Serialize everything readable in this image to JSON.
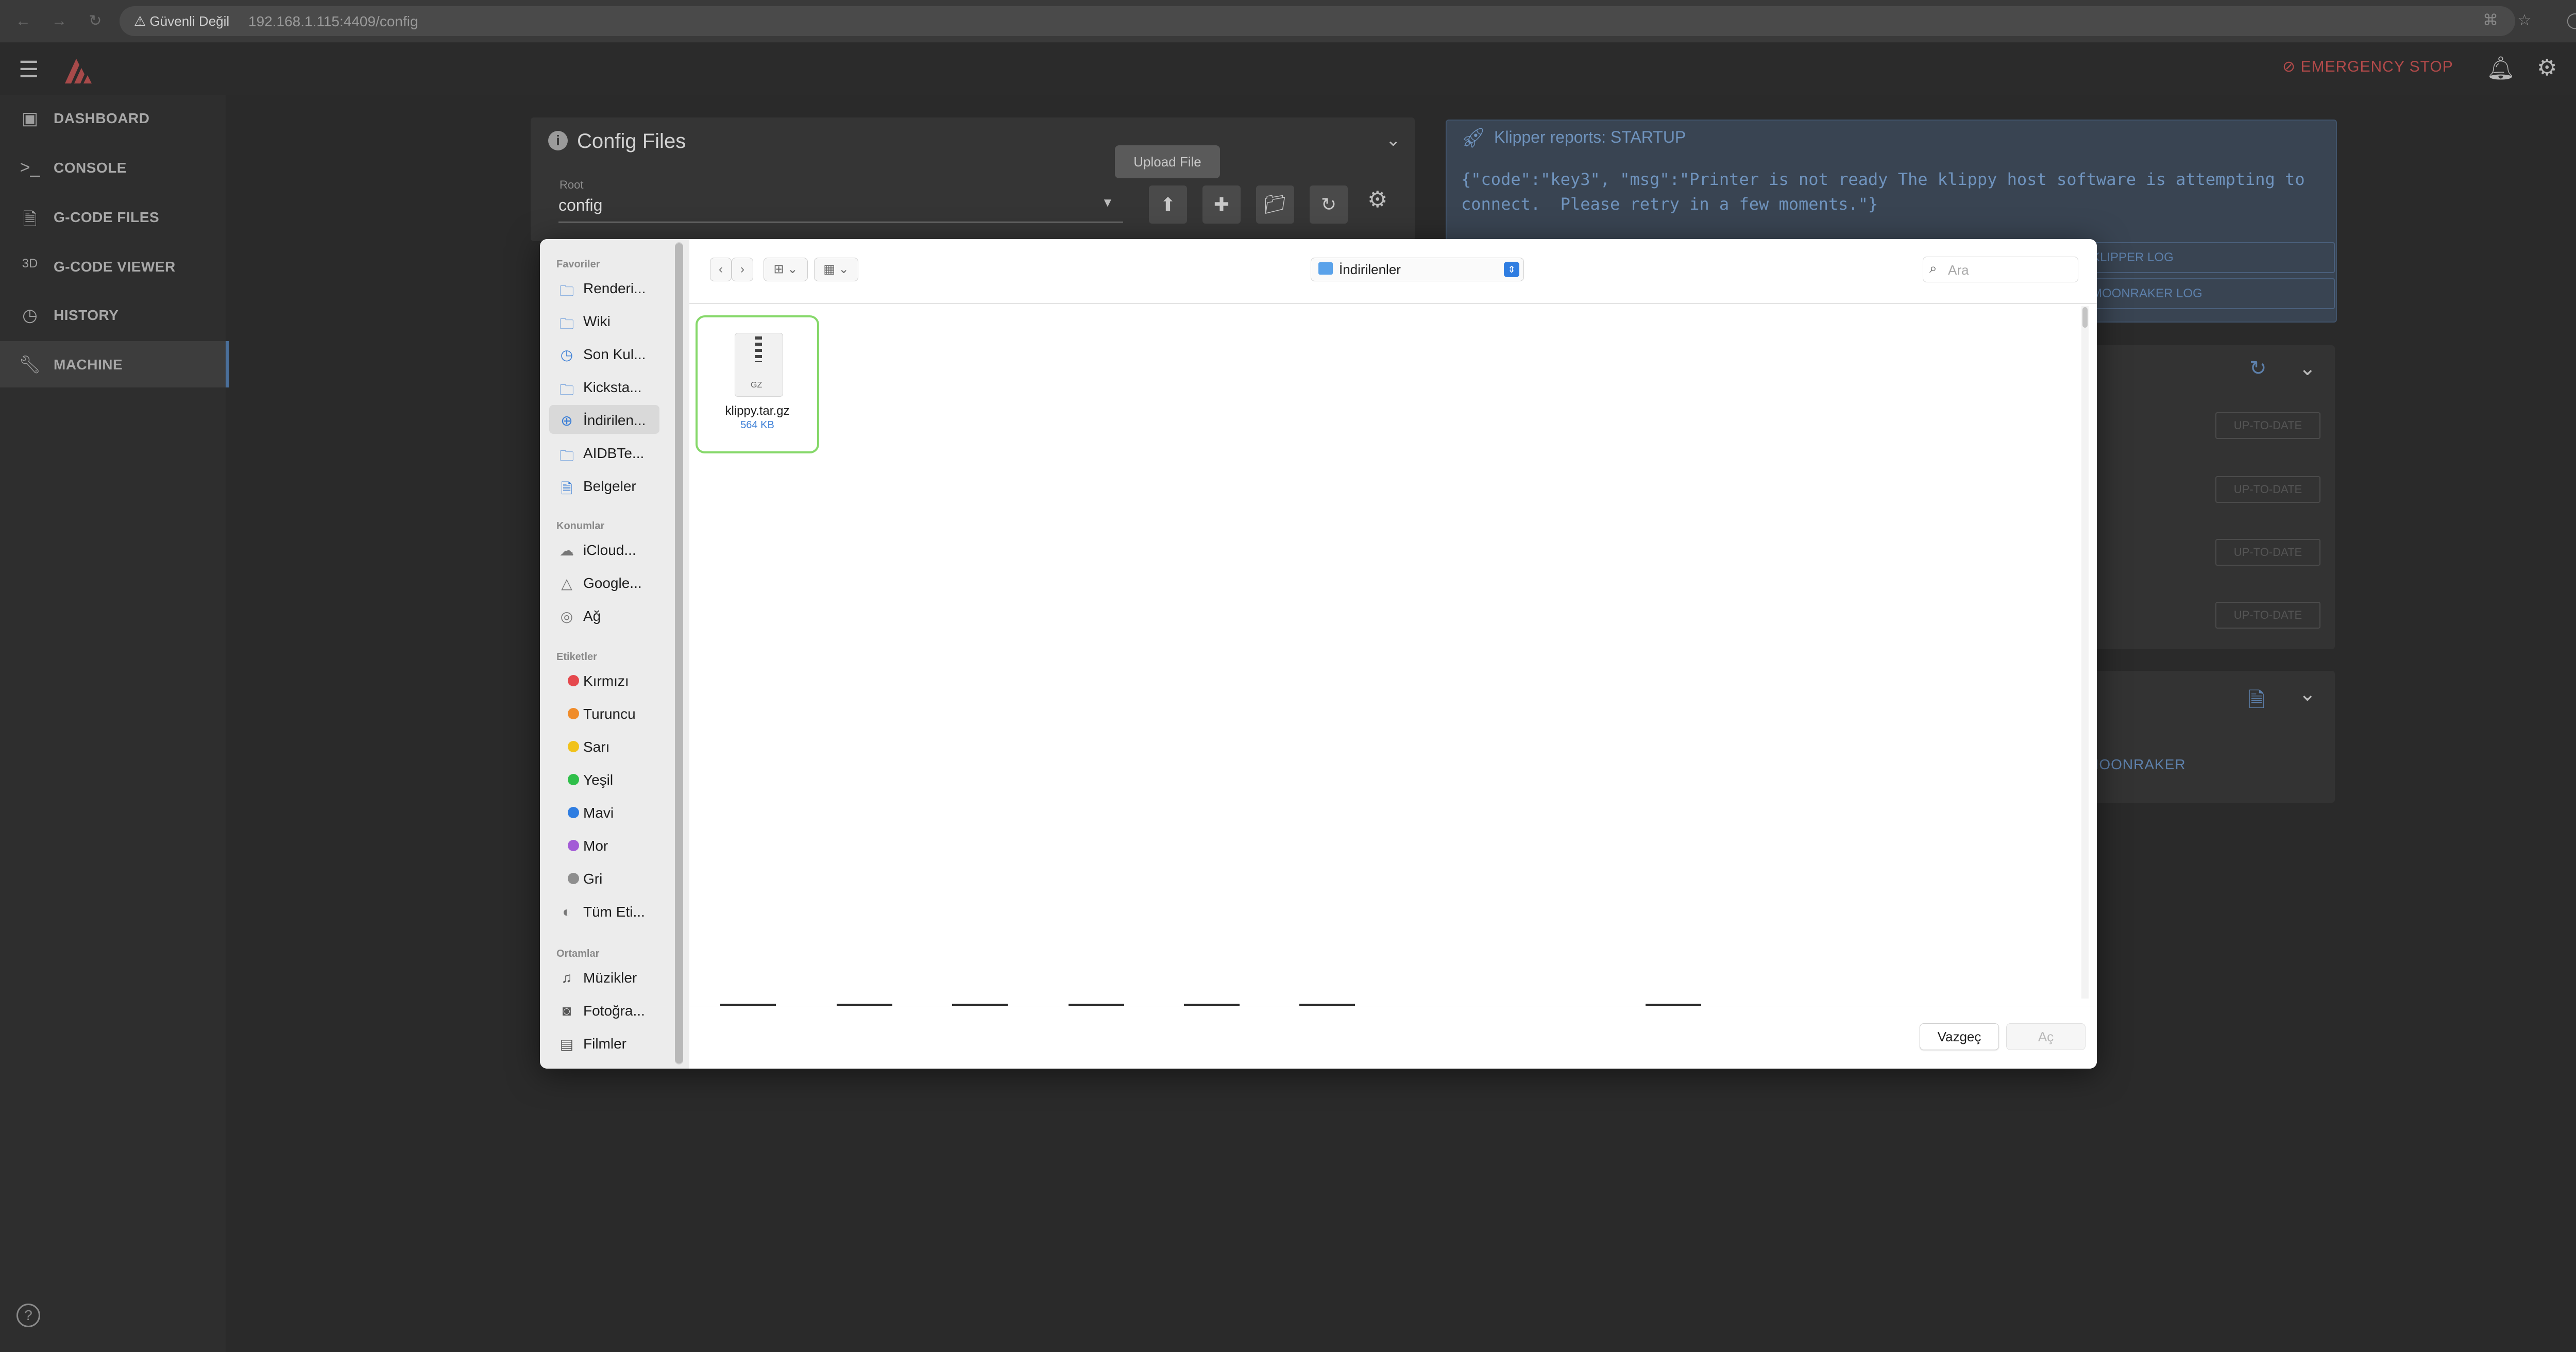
{
  "browser": {
    "security_label": "Güvenli Değil",
    "url": "192.168.1.115:4409/config"
  },
  "header": {
    "estop_label": "EMERGENCY STOP"
  },
  "sidebar": {
    "items": [
      {
        "label": "DASHBOARD",
        "icon": "dashboard-icon"
      },
      {
        "label": "CONSOLE",
        "icon": "console-icon"
      },
      {
        "label": "G-CODE FILES",
        "icon": "file-icon"
      },
      {
        "label": "G-CODE VIEWER",
        "icon": "3d-icon",
        "glyph": "3D"
      },
      {
        "label": "HISTORY",
        "icon": "history-icon"
      },
      {
        "label": "MACHINE",
        "icon": "wrench-icon"
      }
    ]
  },
  "config_panel": {
    "title": "Config Files",
    "root_label": "Root",
    "root_value": "config",
    "upload_tooltip": "Upload File"
  },
  "klipper_panel": {
    "title": "Klipper reports: STARTUP",
    "message": "{\"code\":\"key3\", \"msg\":\"Printer is not ready The klippy host software is attempting to\nconnect.  Please retry in a few moments.\"}",
    "btn_klipper_log": "KLIPPER LOG",
    "btn_moonraker_log": "MOONRAKER LOG"
  },
  "update_panel": {
    "badges": [
      "UP-TO-DATE",
      "UP-TO-DATE",
      "UP-TO-DATE",
      "UP-TO-DATE"
    ],
    "moonraker_btn": "MOONRAKER"
  },
  "file_dialog": {
    "sections": {
      "favorites": "Favoriler",
      "locations": "Konumlar",
      "tags": "Etiketler",
      "media": "Ortamlar"
    },
    "favorites": [
      {
        "label": "Renderi...",
        "icon": "folder-icon"
      },
      {
        "label": "Wiki",
        "icon": "folder-icon"
      },
      {
        "label": "Son Kul...",
        "icon": "clock-icon"
      },
      {
        "label": "Kicksta...",
        "icon": "folder-icon"
      },
      {
        "label": "İndirilen...",
        "icon": "download-icon"
      },
      {
        "label": "AIDBTe...",
        "icon": "folder-icon"
      },
      {
        "label": "Belgeler",
        "icon": "document-icon"
      }
    ],
    "locations": [
      {
        "label": "iCloud...",
        "icon": "cloud-icon"
      },
      {
        "label": "Google...",
        "icon": "drive-icon"
      },
      {
        "label": "Ağ",
        "icon": "globe-icon"
      }
    ],
    "tags": [
      {
        "label": "Kırmızı",
        "color": "#e5484d"
      },
      {
        "label": "Turuncu",
        "color": "#f08c2a"
      },
      {
        "label": "Sarı",
        "color": "#f1c21b"
      },
      {
        "label": "Yeşil",
        "color": "#2fbf4a"
      },
      {
        "label": "Mavi",
        "color": "#2f7de1"
      },
      {
        "label": "Mor",
        "color": "#a35bd6"
      },
      {
        "label": "Gri",
        "color": "#8e8e8e"
      },
      {
        "label": "Tüm Eti...",
        "color": ""
      }
    ],
    "media": [
      {
        "label": "Müzikler",
        "icon": "music-icon"
      },
      {
        "label": "Fotoğra...",
        "icon": "camera-icon"
      },
      {
        "label": "Filmler",
        "icon": "film-icon"
      }
    ],
    "location": "İndirilenler",
    "search_placeholder": "Ara",
    "file": {
      "name": "klippy.tar.gz",
      "size": "564 KB",
      "ext": "GZ"
    },
    "cancel_label": "Vazgeç",
    "open_label": "Aç"
  }
}
